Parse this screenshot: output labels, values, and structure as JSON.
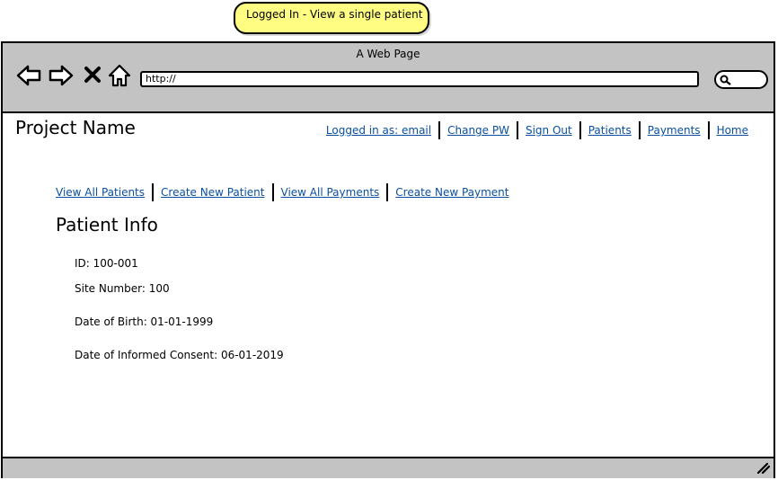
{
  "note": {
    "text": "Logged In - View a single patient"
  },
  "browser": {
    "title": "A Web Page",
    "url": "http://",
    "nav_icons": [
      "back-arrow-icon",
      "forward-arrow-icon",
      "close-icon",
      "home-icon"
    ]
  },
  "header": {
    "project_name": "Project Name",
    "nav": [
      {
        "label": "Logged in as: email"
      },
      {
        "label": "Change PW"
      },
      {
        "label": "Sign Out"
      },
      {
        "label": "Patients"
      },
      {
        "label": "Payments"
      },
      {
        "label": "Home"
      }
    ]
  },
  "subnav": [
    {
      "label": "View All Patients"
    },
    {
      "label": "Create New Patient"
    },
    {
      "label": "View All Payments"
    },
    {
      "label": "Create New Payment"
    }
  ],
  "patient": {
    "heading": "Patient Info",
    "id": "ID: 100-001",
    "site_number": "Site Number: 100",
    "dob": "Date of Birth: 01-01-1999",
    "consent": "Date of Informed Consent: 06-01-2019"
  },
  "colors": {
    "link": "#0b4fa1",
    "chrome": "#c3c3c3",
    "note": "#fffd82"
  }
}
